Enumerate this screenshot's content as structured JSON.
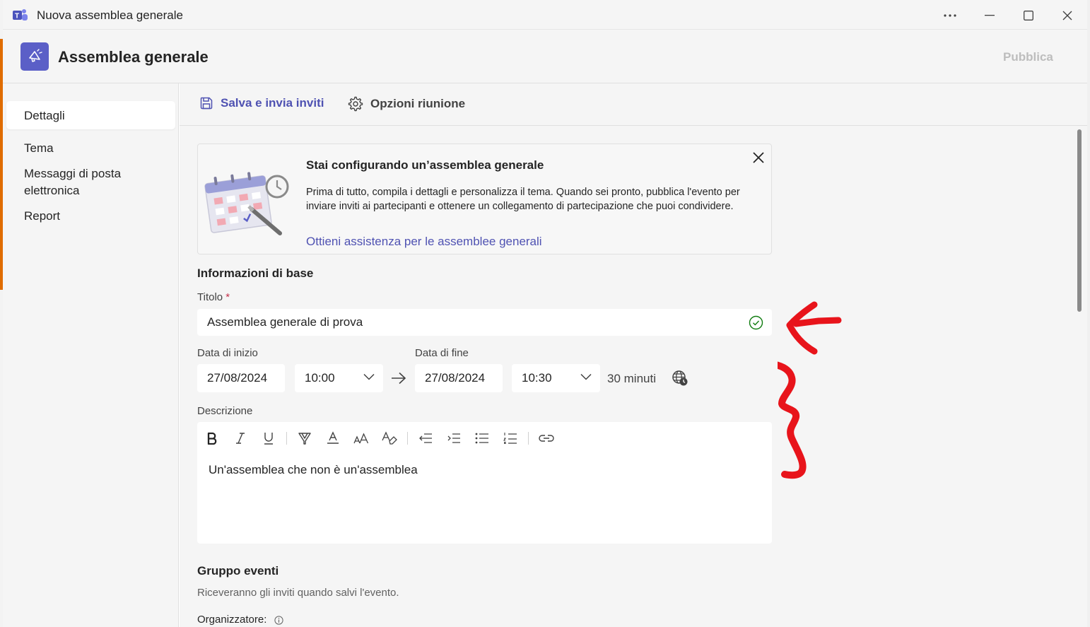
{
  "window": {
    "title": "Nuova assemblea generale"
  },
  "header": {
    "title": "Assemblea generale",
    "publish_label": "Pubblica"
  },
  "sidebar": {
    "items": [
      {
        "label": "Dettagli",
        "active": true
      },
      {
        "label": "Tema"
      },
      {
        "label": "Messaggi di posta elettronica"
      },
      {
        "label": "Report"
      }
    ]
  },
  "toolbar": {
    "save_label": "Salva e invia inviti",
    "options_label": "Opzioni riunione"
  },
  "banner": {
    "title": "Stai configurando un’assemblea generale",
    "text": "Prima di tutto, compila i dettagli e personalizza il tema. Quando sei pronto, pubblica l'evento per inviare inviti ai partecipanti e ottenere un collegamento di partecipazione che puoi condividere.",
    "link": "Ottieni assistenza per le assemblee generali"
  },
  "basic_info": {
    "section_title": "Informazioni di base",
    "title_label": "Titolo",
    "required_mark": "*",
    "title_value": "Assemblea generale di prova",
    "start_label": "Data di inizio",
    "start_date": "27/08/2024",
    "start_time": "10:00",
    "end_label": "Data di fine",
    "end_date": "27/08/2024",
    "end_time": "10:30",
    "duration": "30 minuti",
    "description_label": "Descrizione",
    "description_value": "Un'assemblea che non è un'assemblea"
  },
  "event_group": {
    "section_title": "Gruppo eventi",
    "subtitle": "Riceveranno gli inviti quando salvi l'evento.",
    "organizer_label": "Organizzatore:"
  },
  "colors": {
    "brand": "#5b5fc7",
    "link": "#4f52b2",
    "success": "#107c10",
    "annotation": "#e8141b"
  }
}
